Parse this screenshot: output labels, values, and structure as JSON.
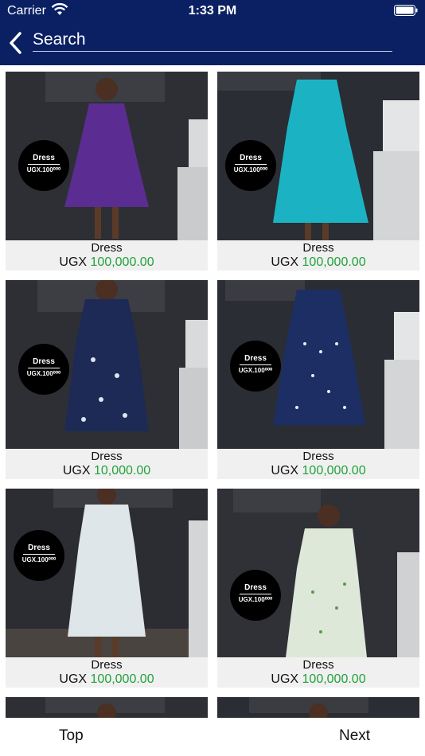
{
  "status_bar": {
    "carrier": "Carrier",
    "time": "1:33 PM"
  },
  "header": {
    "back_icon": "chevron-left-icon",
    "search_placeholder": "Search"
  },
  "products": [
    {
      "name": "Dress",
      "currency": "UGX",
      "amount": "100,000.00",
      "badge_title": "Dress",
      "badge_price": "UGX.100⁰⁰⁰",
      "dress_color": "#5b2c91",
      "bg": "#2d2f35"
    },
    {
      "name": "Dress",
      "currency": "UGX",
      "amount": "100,000.00",
      "badge_title": "Dress",
      "badge_price": "UGX.100⁰⁰⁰",
      "dress_color": "#1bb3c4",
      "bg": "#2a2d33"
    },
    {
      "name": "Dress",
      "currency": "UGX",
      "amount": "10,000.00",
      "badge_title": "Dress",
      "badge_price": "UGX.100⁰⁰⁰",
      "dress_color": "#1d2a55",
      "bg": "#2d2f35"
    },
    {
      "name": "Dress",
      "currency": "UGX",
      "amount": "100,000.00",
      "badge_title": "Dress",
      "badge_price": "UGX.100⁰⁰⁰",
      "dress_color": "#1c2e63",
      "bg": "#2a2d33"
    },
    {
      "name": "Dress",
      "currency": "UGX",
      "amount": "100,000.00",
      "badge_title": "Dress",
      "badge_price": "UGX.100⁰⁰⁰",
      "dress_color": "#dfe6ea",
      "bg": "#2b2d32"
    },
    {
      "name": "Dress",
      "currency": "UGX",
      "amount": "100,000.00",
      "badge_title": "Dress",
      "badge_price": "UGX.100⁰⁰⁰",
      "dress_color": "#dde8d9",
      "bg": "#2f3136"
    }
  ],
  "footer": {
    "top_label": "Top",
    "next_label": "Next"
  },
  "colors": {
    "header_bg": "#0a2063",
    "price_green": "#22a23a",
    "caption_bg": "#f0f0f0"
  }
}
